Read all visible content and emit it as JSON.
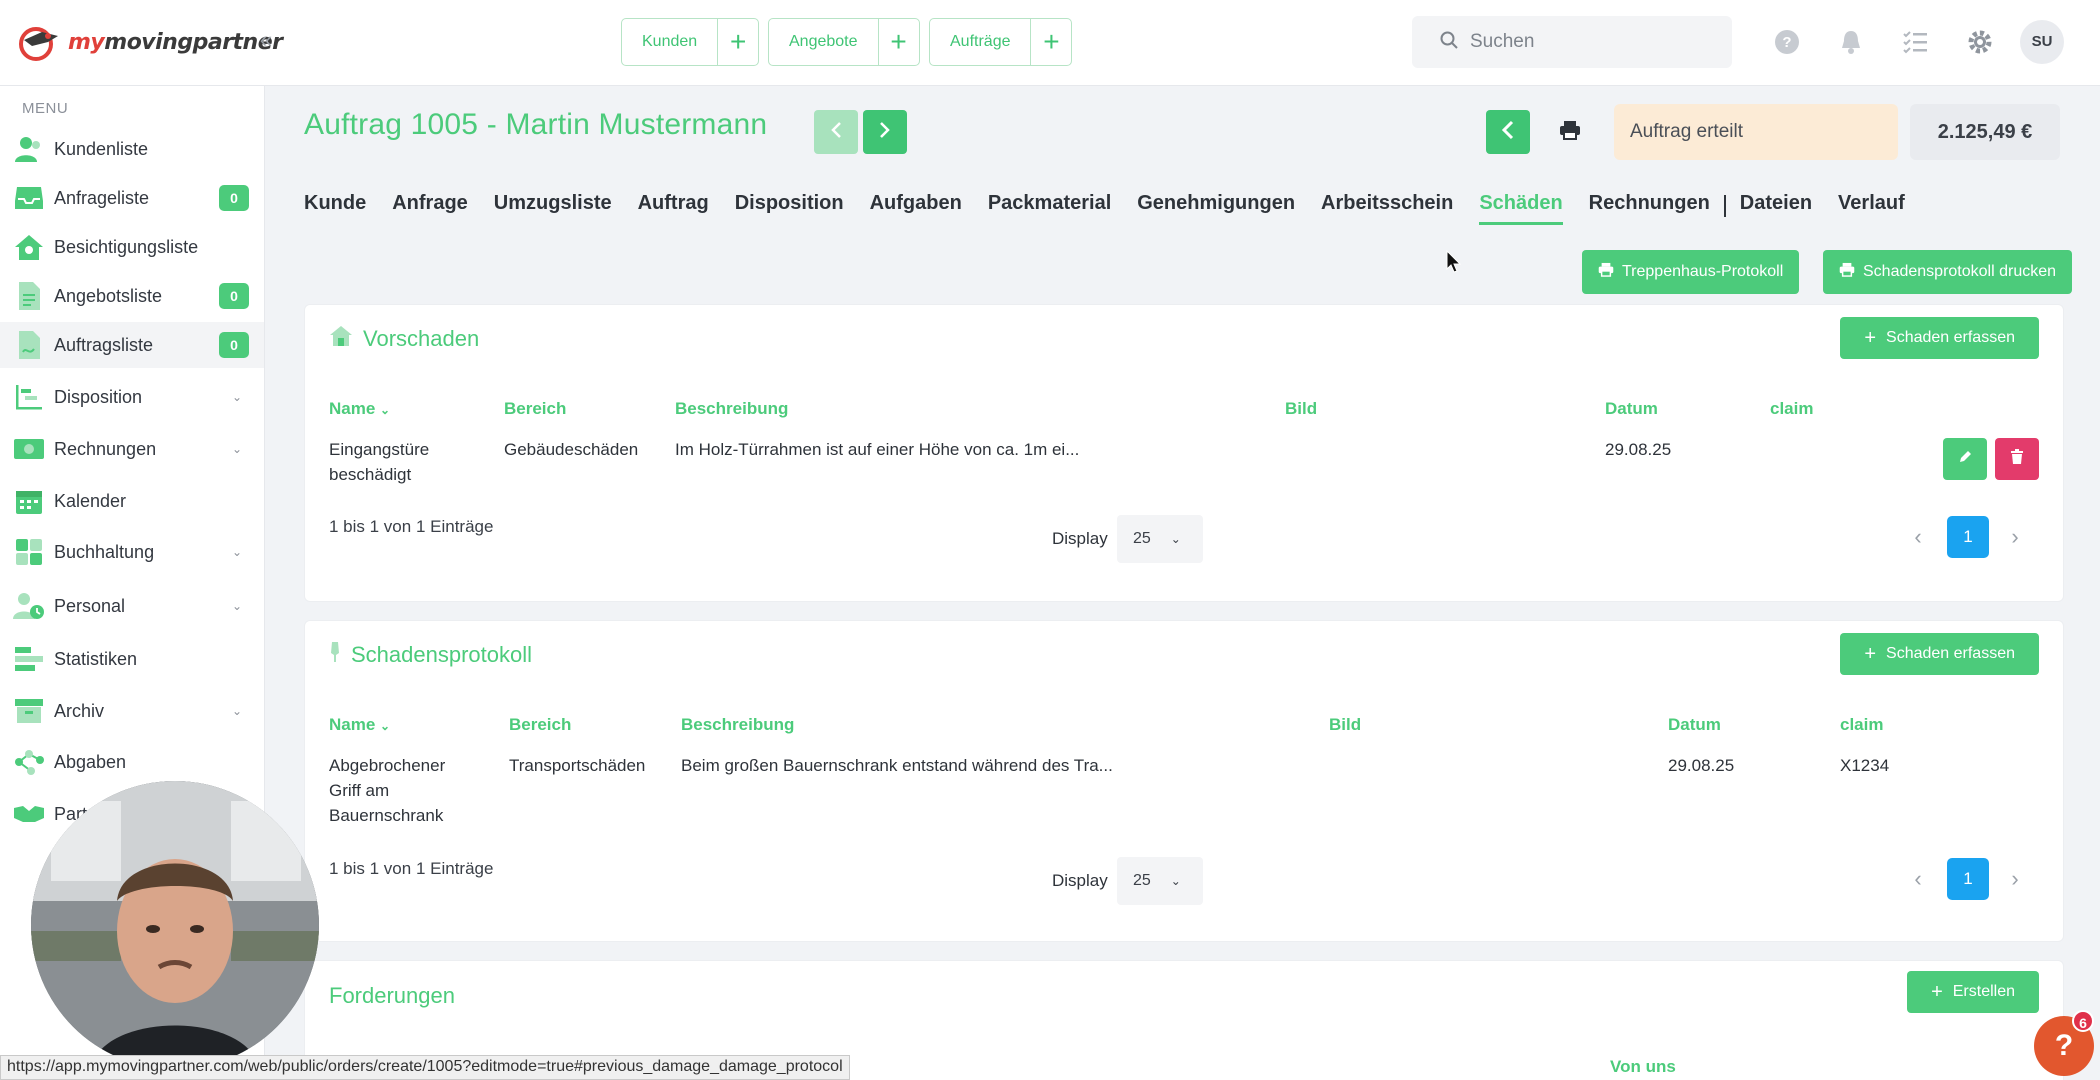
{
  "brand": {
    "name_part1": "my",
    "name_part2": "movingpartner"
  },
  "quick_links": [
    {
      "label": "Kunden"
    },
    {
      "label": "Angebote"
    },
    {
      "label": "Aufträge"
    }
  ],
  "search": {
    "placeholder": "Suchen"
  },
  "user": {
    "initials": "SU"
  },
  "sidebar": {
    "menu_label": "MENU",
    "items": [
      {
        "label": "Kundenliste"
      },
      {
        "label": "Anfrageliste",
        "badge": "0"
      },
      {
        "label": "Besichtigungsliste"
      },
      {
        "label": "Angebotsliste",
        "badge": "0"
      },
      {
        "label": "Auftragsliste",
        "badge": "0"
      },
      {
        "label": "Disposition"
      },
      {
        "label": "Rechnungen"
      },
      {
        "label": "Kalender"
      },
      {
        "label": "Buchhaltung"
      },
      {
        "label": "Personal"
      },
      {
        "label": "Statistiken"
      },
      {
        "label": "Archiv"
      },
      {
        "label": "Abgaben"
      },
      {
        "label": "Part"
      }
    ]
  },
  "order": {
    "title": "Auftrag 1005 - Martin Mustermann",
    "status": "Auftrag erteilt",
    "amount": "2.125,49 €"
  },
  "tabs": [
    {
      "label": "Kunde"
    },
    {
      "label": "Anfrage"
    },
    {
      "label": "Umzugsliste"
    },
    {
      "label": "Auftrag"
    },
    {
      "label": "Disposition"
    },
    {
      "label": "Aufgaben"
    },
    {
      "label": "Packmaterial"
    },
    {
      "label": "Genehmigungen"
    },
    {
      "label": "Arbeitsschein"
    },
    {
      "label": "Schäden"
    },
    {
      "label": "Rechnungen"
    },
    {
      "label": "Dateien"
    },
    {
      "label": "Verlauf"
    }
  ],
  "actions": {
    "stairwell_protocol": "Treppenhaus-Protokoll",
    "print_damage_protocol": "Schadensprotokoll drucken"
  },
  "vorschaden": {
    "title": "Vorschaden",
    "add_label": "Schaden erfassen",
    "columns": {
      "name": "Name",
      "area": "Bereich",
      "description": "Beschreibung",
      "image": "Bild",
      "date": "Datum",
      "claim": "claim"
    },
    "rows": [
      {
        "name_line1": "Eingangstüre",
        "name_line2": "beschädigt",
        "area": "Gebäudeschäden",
        "description": "Im Holz-Türrahmen ist auf einer Höhe von ca. 1m ei...",
        "date": "29.08.25",
        "claim": ""
      }
    ],
    "entries": "1 bis 1 von 1 Einträge",
    "display_label": "Display",
    "page_size": "25",
    "page": "1"
  },
  "schadensprotokoll": {
    "title": "Schadensprotokoll",
    "add_label": "Schaden erfassen",
    "columns": {
      "name": "Name",
      "area": "Bereich",
      "description": "Beschreibung",
      "image": "Bild",
      "date": "Datum",
      "claim": "claim"
    },
    "rows": [
      {
        "name_line1": "Abgebrochener",
        "name_line2": "Griff am",
        "name_line3": "Bauernschrank",
        "area": "Transportschäden",
        "description": "Beim großen Bauernschrank entstand während des Tra...",
        "date": "29.08.25",
        "claim": "X1234"
      }
    ],
    "entries": "1 bis 1 von 1 Einträge",
    "display_label": "Display",
    "page_size": "25",
    "page": "1"
  },
  "forderungen": {
    "title": "Forderungen",
    "create_label": "Erstellen",
    "column_from_us": "Von uns"
  },
  "browser_status_url": "https://app.mymovingpartner.com/web/public/orders/create/1005?editmode=true#previous_damage_damage_protocol",
  "help": {
    "label": "?",
    "badge": "6"
  },
  "colors": {
    "accent": "#4ccb7b",
    "accent_light": "#a8e2bd",
    "status_bg": "#fcebd6",
    "pager_blue": "#1aa3f0",
    "danger": "#e33b6b"
  }
}
